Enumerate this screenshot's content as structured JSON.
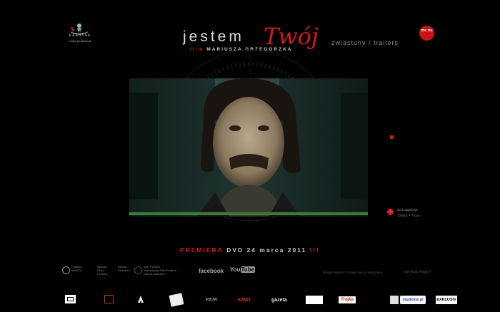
{
  "header": {
    "logo": {
      "brand": "KAKAYAK",
      "sub": "f.toles producenta"
    },
    "title_word1": "jestem",
    "title_word2": "Twój",
    "subtitle_film": "film",
    "subtitle_director": "MARIUSZA GRZEGORZKA",
    "trailers": "zwiastuny / trailers",
    "menu_label": "me nu"
  },
  "video": {
    "progress_fraction": 1.0
  },
  "download": {
    "line1": "do ściągnięcia",
    "line2": "1280px × 702px"
  },
  "premiere": {
    "label": "PREMIERA",
    "text": "DVD 24 marca 2011",
    "exclaim": "!!!"
  },
  "festivals": [
    {
      "l1": "Festival",
      "l2": "MIASTO",
      "l3": ""
    },
    {
      "l1": "Warsaw",
      "l2": "FILM",
      "l3": "Festival"
    },
    {
      "l1": "Official",
      "l2": "Selection",
      "l3": ""
    },
    {
      "l1": "15th PUSAN",
      "l2": "International Film Festival",
      "l3": "Official Selection"
    }
  ],
  "social": {
    "facebook": "facebook",
    "youtube_you": "You",
    "youtube_tube": "Tube"
  },
  "footer": {
    "design": "Design Mariusz Grzegorzek   &   Harry Fiers",
    "flash": "Get Flash Player"
  },
  "sponsors": {
    "film": "FILM",
    "kino": "KINO",
    "gazeta": "gazeta",
    "trojka": "Trójka",
    "students": "students.pl",
    "exklusiv": "EXKLUSIV"
  },
  "colors": {
    "accent": "#d21a1a",
    "background": "#000000"
  }
}
